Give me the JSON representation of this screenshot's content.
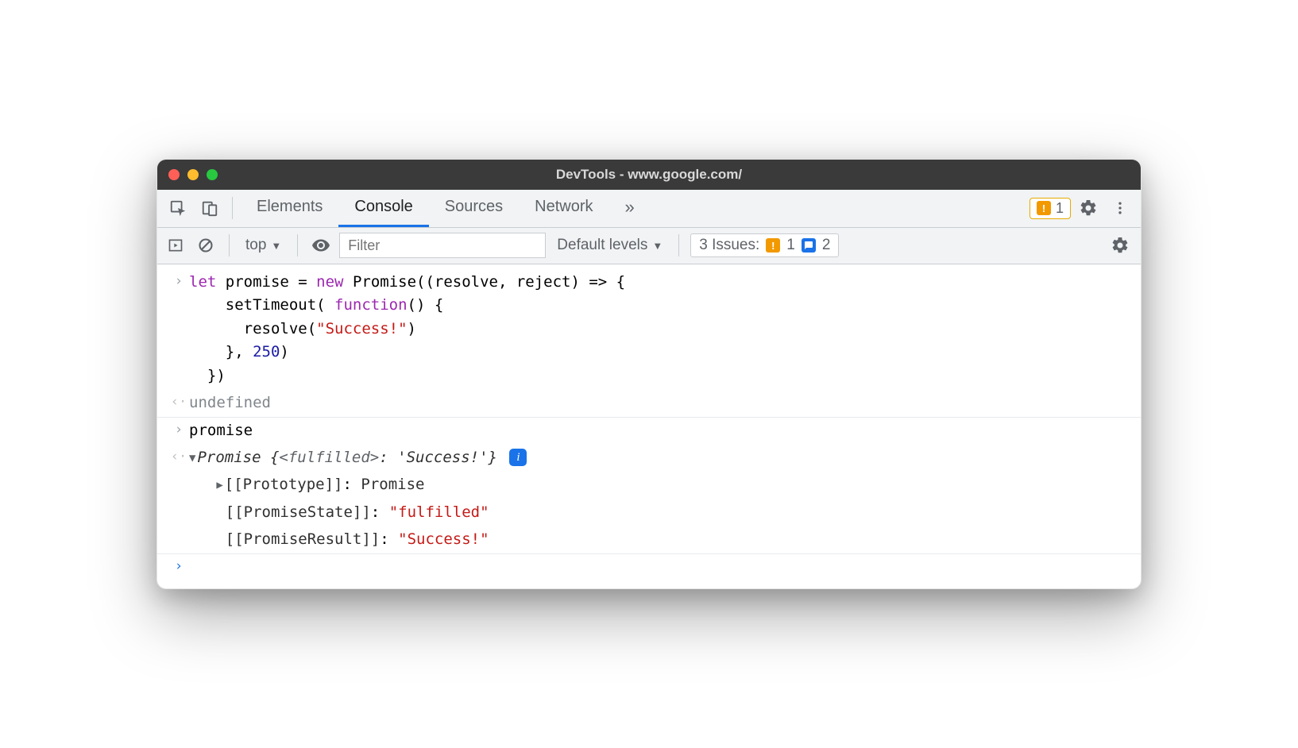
{
  "window": {
    "title": "DevTools - www.google.com/"
  },
  "tabs": {
    "elements": "Elements",
    "console": "Console",
    "sources": "Sources",
    "network": "Network"
  },
  "warning_badge": {
    "count": "1"
  },
  "subbar": {
    "context": "top",
    "filter_placeholder": "Filter",
    "levels": "Default levels",
    "issues_label": "3 Issues:",
    "issues_warn": "1",
    "issues_info": "2"
  },
  "console_lines": {
    "code1": {
      "let": "let",
      "promise_eq": " promise = ",
      "new": "new",
      "promise_open": " Promise((resolve, reject) => {",
      "l2a": "    setTimeout( ",
      "func": "function",
      "l2b": "() {",
      "l3a": "      resolve(",
      "str": "\"Success!\"",
      "l3b": ")",
      "l4a": "    }, ",
      "num": "250",
      "l4b": ")",
      "l5": "  })"
    },
    "result1": "undefined",
    "code2": "promise",
    "result2": {
      "prefix": "Promise",
      "open": " {",
      "state_key": "<fulfilled>",
      "colon": ": ",
      "state_val": "'Success!'",
      "close": "}"
    },
    "props": {
      "proto_key": "[[Prototype]]",
      "proto_val": "Promise",
      "state_key": "[[PromiseState]]",
      "state_val": "\"fulfilled\"",
      "result_key": "[[PromiseResult]]",
      "result_val": "\"Success!\""
    }
  }
}
